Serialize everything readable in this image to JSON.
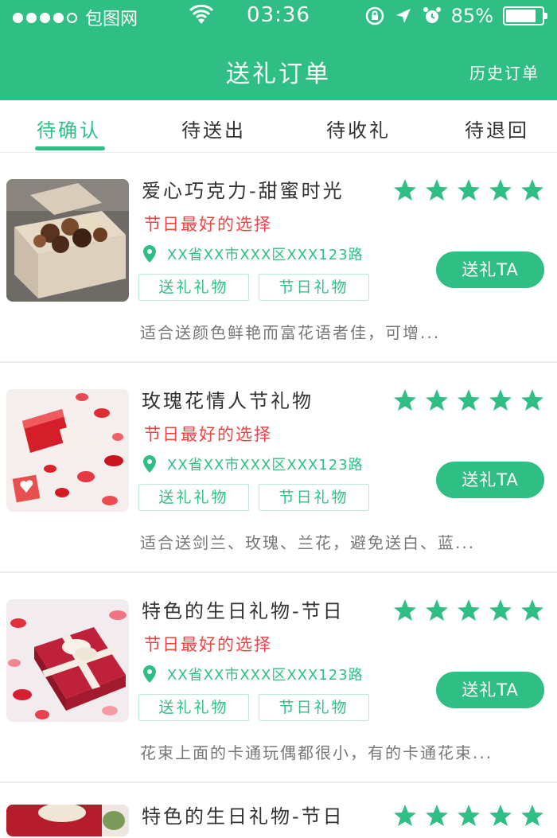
{
  "status_bar": {
    "carrier": "包图网",
    "time": "03:36",
    "battery": "85%",
    "battery_level": 0.85,
    "icons": [
      "signal-dots",
      "wifi-icon",
      "rotation-lock-icon",
      "location-arrow-icon",
      "alarm-icon",
      "battery-icon"
    ]
  },
  "header": {
    "title": "送礼订单",
    "history_label": "历史订单"
  },
  "tabs": [
    {
      "label": "待确认",
      "active": true
    },
    {
      "label": "待送出",
      "active": false
    },
    {
      "label": "待收礼",
      "active": false
    },
    {
      "label": "待退回",
      "active": false
    }
  ],
  "colors": {
    "brand": "#2fbf85",
    "highlight": "#f24141",
    "text": "#333333",
    "muted": "#777777"
  },
  "orders": [
    {
      "title": "爱心巧克力-甜蜜时光",
      "rating": 5,
      "subtitle": "节日最好的选择",
      "address": "XX省XX市XXX区XXX123路",
      "tags": [
        "送礼礼物",
        "节日礼物"
      ],
      "button": "送礼TA",
      "description": "适合送颜色鲜艳而富花语者佳，可增...",
      "image": "chocolate-box"
    },
    {
      "title": "玫瑰花情人节礼物",
      "rating": 5,
      "subtitle": "节日最好的选择",
      "address": "XX省XX市XXX区XXX123路",
      "tags": [
        "送礼礼物",
        "节日礼物"
      ],
      "button": "送礼TA",
      "description": "适合送剑兰、玫瑰、兰花，避免送白、蓝...",
      "image": "rose-petals-gift"
    },
    {
      "title": "特色的生日礼物-节日",
      "rating": 5,
      "subtitle": "节日最好的选择",
      "address": "XX省XX市XXX区XXX123路",
      "tags": [
        "送礼礼物",
        "节日礼物"
      ],
      "button": "送礼TA",
      "description": "花束上面的卡通玩偶都很小，有的卡通花束...",
      "image": "red-gift-box"
    },
    {
      "title": "特色的生日礼物-节日",
      "rating": 5,
      "image": "red-gift-box-partial"
    }
  ]
}
